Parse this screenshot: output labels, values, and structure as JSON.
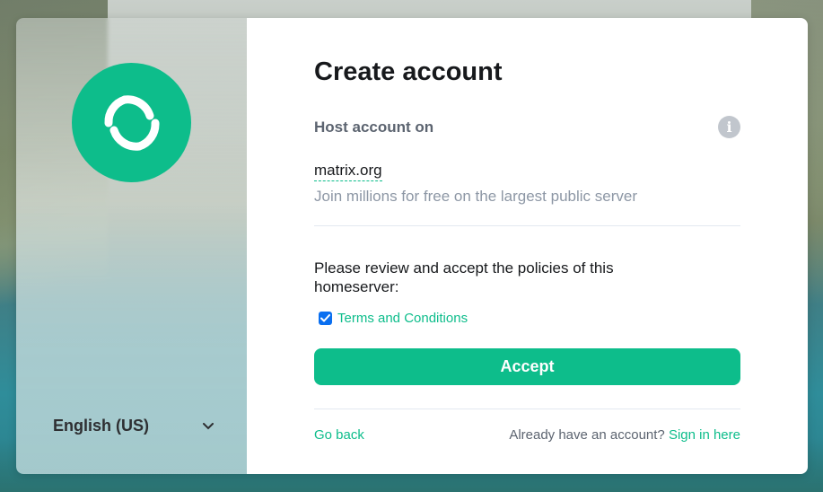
{
  "sidebar": {
    "language": "English (US)"
  },
  "form": {
    "title": "Create account",
    "host_label": "Host account on",
    "server_name": "matrix.org",
    "server_description": "Join millions for free on the largest public server",
    "policy_text": "Please review and accept the policies of this homeserver:",
    "terms_label": "Terms and Conditions",
    "terms_checked": true,
    "accept_label": "Accept"
  },
  "footer": {
    "go_back": "Go back",
    "already_text": "Already have an account?",
    "sign_in": "Sign in here"
  },
  "colors": {
    "accent": "#0dbd8b",
    "checkbox": "#0a6ff0",
    "muted": "#8d97a5"
  },
  "icons": {
    "logo": "element-logo-icon",
    "info": "info-icon",
    "chevron": "chevron-down-icon",
    "check": "checkmark-icon"
  }
}
